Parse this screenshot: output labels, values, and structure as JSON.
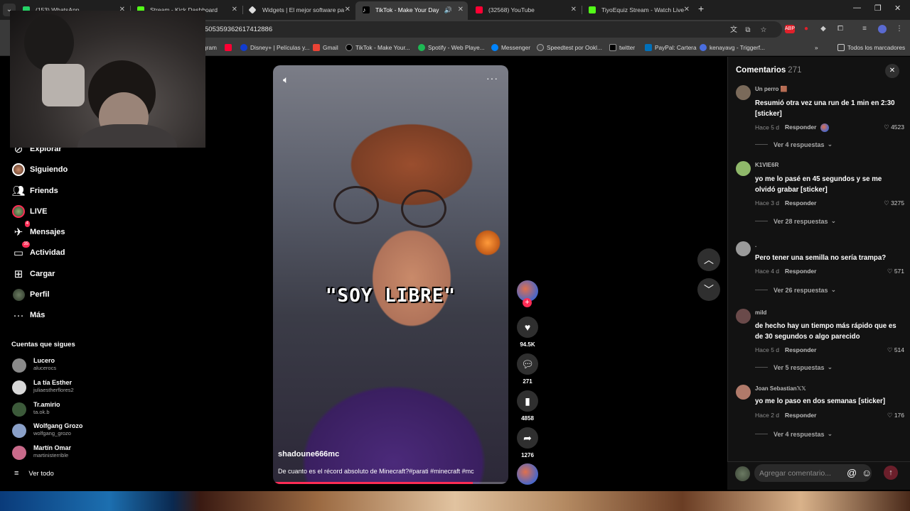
{
  "browser": {
    "tabs": [
      {
        "title": "(153) WhatsApp",
        "color": "#25d366"
      },
      {
        "title": "Stream - Kick Dashboard",
        "color": "#53fc18"
      },
      {
        "title": "Widgets | El mejor software pa",
        "color": "#ffffff"
      },
      {
        "title": "TikTok - Make Your Day",
        "color": "#ffffff"
      },
      {
        "title": "(32568) YouTube",
        "color": "#ff0033"
      },
      {
        "title": "TiyoEquiz Stream - Watch Live",
        "color": "#53fc18"
      }
    ],
    "url": "505359362617412886",
    "bookmarks": [
      {
        "label": "gram",
        "color": "#d62976"
      },
      {
        "label": "",
        "color": "#ff0033"
      },
      {
        "label": "Disney+ | Películas y...",
        "color": "#113ccf"
      },
      {
        "label": "Gmail",
        "color": "#ea4335"
      },
      {
        "label": "TikTok - Make Your...",
        "color": "#ffffff"
      },
      {
        "label": "Spotify - Web Playe...",
        "color": "#1db954"
      },
      {
        "label": "Messenger",
        "color": "#0084ff"
      },
      {
        "label": "Speedtest por Ookl...",
        "color": "#9aa0a6"
      },
      {
        "label": "twitter",
        "color": "#ffffff"
      },
      {
        "label": "PayPal: Cartera",
        "color": "#0070ba"
      },
      {
        "label": "kenayavg - Triggerf...",
        "color": "#4a6ee0"
      }
    ],
    "all_bookmarks": "Todos los marcadores"
  },
  "nav": {
    "items": [
      {
        "label": "Explorar",
        "icon": "compass-icon"
      },
      {
        "label": "Siguiendo",
        "icon": "avatar"
      },
      {
        "label": "Friends",
        "icon": "friends-icon"
      },
      {
        "label": "LIVE",
        "icon": "live-avatar"
      },
      {
        "label": "Mensajes",
        "icon": "paper-plane-icon",
        "badge": "4"
      },
      {
        "label": "Actividad",
        "icon": "inbox-icon",
        "badge": "35"
      },
      {
        "label": "Cargar",
        "icon": "plus-square-icon"
      },
      {
        "label": "Perfil",
        "icon": "avatar"
      },
      {
        "label": "Más",
        "icon": "ellipsis-icon"
      }
    ],
    "following_title": "Cuentas que sigues",
    "accounts": [
      {
        "name": "Lucero",
        "handle": "alucerocs",
        "color": "#8a8a8a"
      },
      {
        "name": "La tía Esther",
        "handle": "juliaestherflores2",
        "color": "#d8d8d8"
      },
      {
        "name": "Tr.amirio",
        "handle": "ta.ok.b",
        "color": "#3c5a3a"
      },
      {
        "name": "Wolfgang Grozo",
        "handle": "wolfgang_grozo",
        "color": "#8aa0c8"
      },
      {
        "name": "Martín Omar",
        "handle": "martinisterrible",
        "color": "#c86a8a"
      }
    ],
    "see_all": "Ver todo"
  },
  "video": {
    "caption": "\"SOY LIBRE\"",
    "username": "shadoune666mc",
    "description": "De cuanto es el récord absoluto de Minecraft?#parati #minecraft #mc",
    "progress": 0.85
  },
  "actions": {
    "likes": "94.5K",
    "comments": "271",
    "saves": "4858",
    "shares": "1276"
  },
  "comments_panel": {
    "title": "Comentarios",
    "count": "271",
    "comments": [
      {
        "user": "Un perro 🟫",
        "text": "Resumió otra vez una run de 1 min en 2:30 [sticker]",
        "time": "Hace 5 d",
        "reply": "Responder",
        "likes": "4523",
        "replies": "Ver 4 respuestas",
        "creator_liked": true,
        "avatar_color": "#7a6a5a"
      },
      {
        "user": "K1VIE6R",
        "text": "yo me lo pasé en 45 segundos y se me olvidó grabar [sticker]",
        "time": "Hace 3 d",
        "reply": "Responder",
        "likes": "3275",
        "replies": "Ver 28 respuestas",
        "creator_liked": false,
        "avatar_color": "#8fb86a"
      },
      {
        "user": ".",
        "text": "Pero tener una semilla no sería trampa?",
        "time": "Hace 4 d",
        "reply": "Responder",
        "likes": "571",
        "replies": "Ver 26 respuestas",
        "creator_liked": false,
        "avatar_color": "#9a9a9a"
      },
      {
        "user": "mild",
        "text": "de hecho hay un tiempo más rápido que es de 30 segundos o algo parecido",
        "time": "Hace 5 d",
        "reply": "Responder",
        "likes": "514",
        "replies": "Ver 5 respuestas",
        "creator_liked": false,
        "avatar_color": "#6a4a4a"
      },
      {
        "user": "Joan Sebastian𝕏𝕏",
        "text": "yo me lo paso en dos semanas [sticker]",
        "time": "Hace 2 d",
        "reply": "Responder",
        "likes": "176",
        "replies": "Ver 4 respuestas",
        "creator_liked": false,
        "avatar_color": "#b07a6a"
      }
    ],
    "input_placeholder": "Agregar comentario..."
  }
}
